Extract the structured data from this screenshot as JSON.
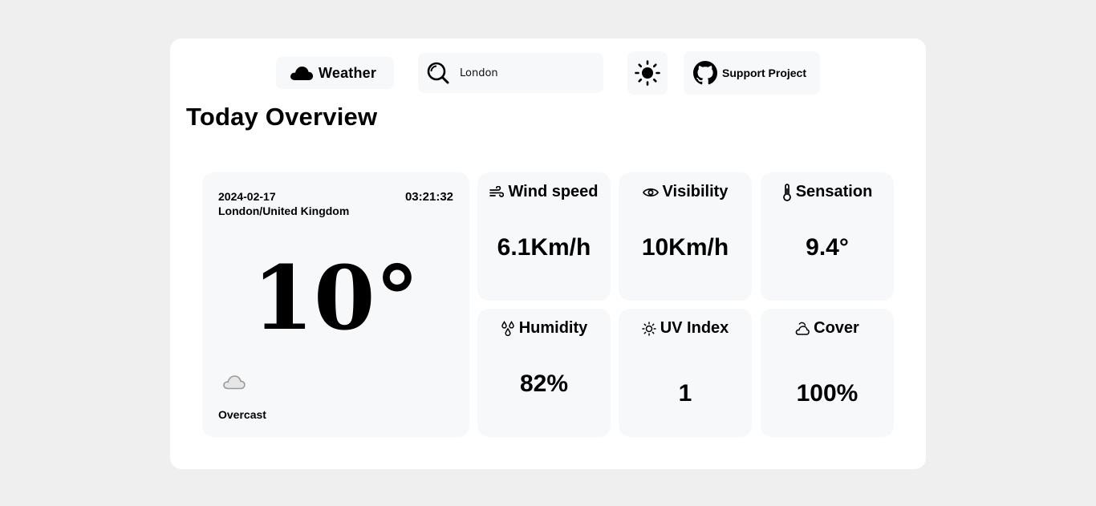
{
  "header": {
    "brand_label": "Weather",
    "search_value": "London",
    "search_placeholder": "",
    "support_label": "Support Project"
  },
  "page_title": "Today Overview",
  "current": {
    "date": "2024-02-17",
    "time": "03:21:32",
    "location": "London/United Kingdom",
    "temperature": "10°",
    "condition": "Overcast",
    "condition_icon": "cloud-icon"
  },
  "stats": [
    {
      "label": "Wind speed",
      "value": "6.1Km/h",
      "icon": "wind-icon"
    },
    {
      "label": "Visibility",
      "value": "10Km/h",
      "icon": "eye-icon"
    },
    {
      "label": "Sensation",
      "value": "9.4°",
      "icon": "thermometer-icon"
    },
    {
      "label": "Humidity",
      "value": "82%",
      "icon": "droplets-icon"
    },
    {
      "label": "UV Index",
      "value": "1",
      "icon": "sun-icon"
    },
    {
      "label": "Cover",
      "value": "100%",
      "icon": "cloud-sun-icon"
    }
  ]
}
